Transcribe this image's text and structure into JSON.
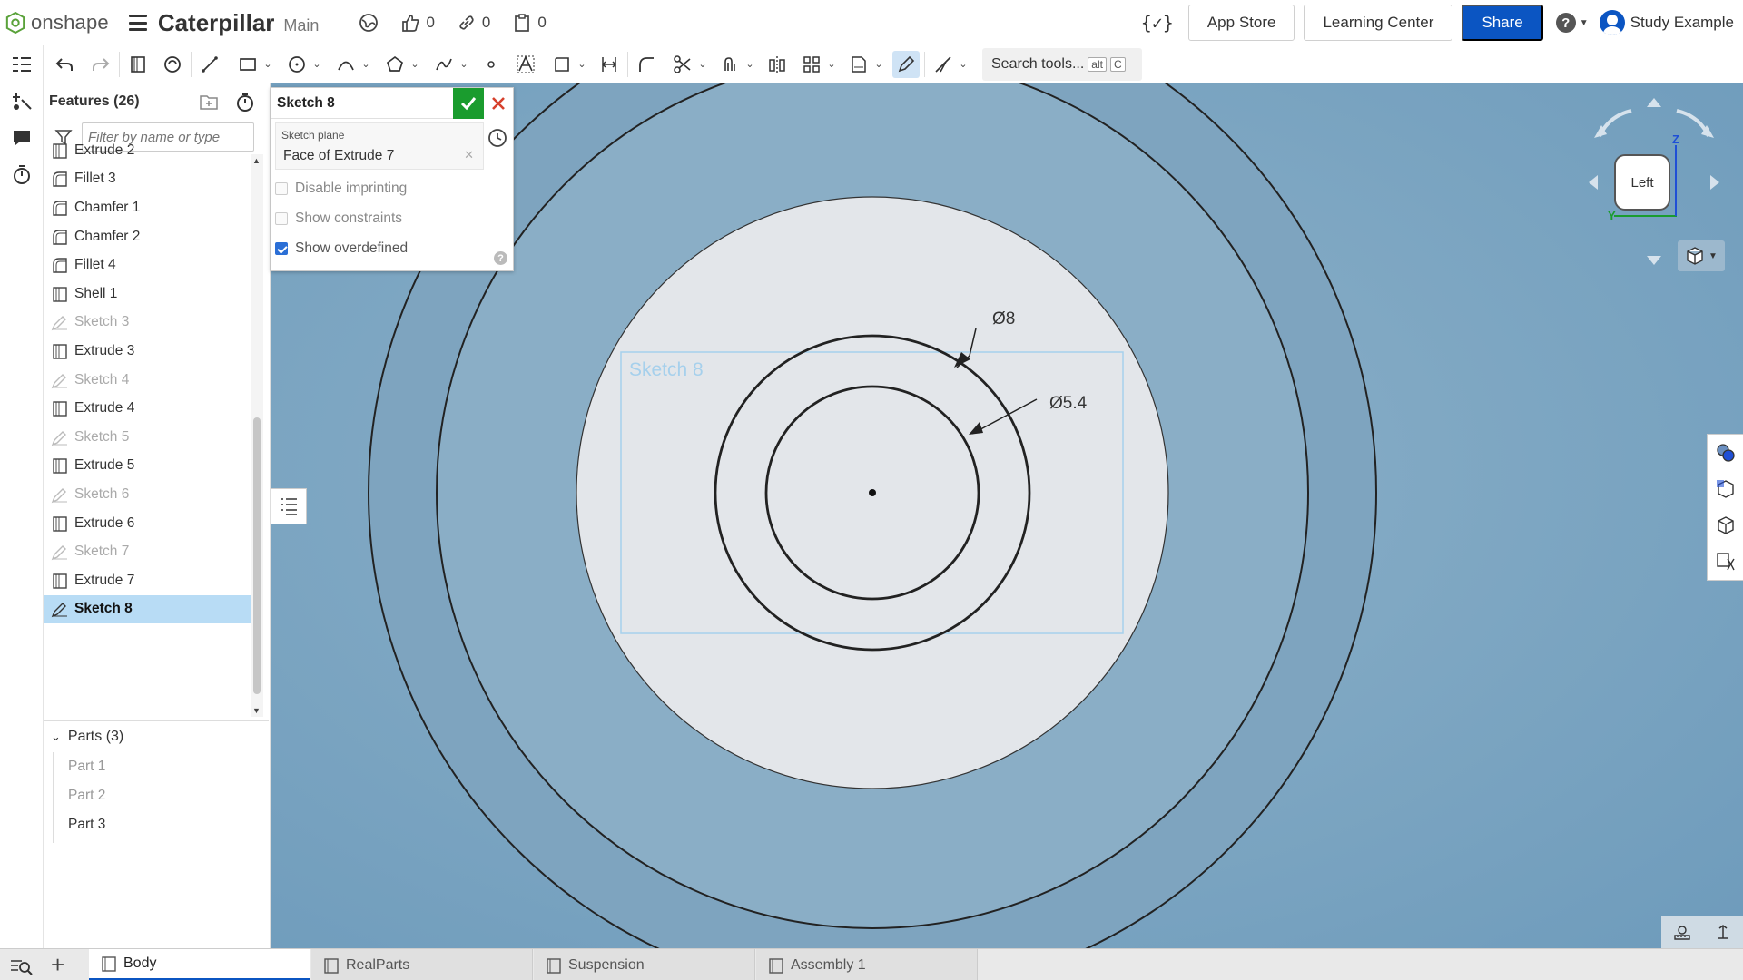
{
  "header": {
    "logo_text": "onshape",
    "doc_title": "Caterpillar",
    "branch": "Main",
    "likes": "0",
    "links": "0",
    "copies": "0",
    "app_store": "App Store",
    "learning_center": "Learning Center",
    "share": "Share",
    "user_name": "Study Example"
  },
  "toolbar": {
    "search_placeholder": "Search tools...",
    "search_key1": "alt",
    "search_key2": "C"
  },
  "features": {
    "title": "Features (26)",
    "filter_placeholder": "Filter by name or type",
    "items": [
      {
        "label": "Extrude 2",
        "type": "extrude"
      },
      {
        "label": "Fillet 3",
        "type": "fillet"
      },
      {
        "label": "Chamfer 1",
        "type": "chamfer"
      },
      {
        "label": "Chamfer 2",
        "type": "chamfer"
      },
      {
        "label": "Fillet 4",
        "type": "fillet"
      },
      {
        "label": "Shell 1",
        "type": "shell"
      },
      {
        "label": "Sketch 3",
        "type": "sketch"
      },
      {
        "label": "Extrude 3",
        "type": "extrude"
      },
      {
        "label": "Sketch 4",
        "type": "sketch"
      },
      {
        "label": "Extrude 4",
        "type": "extrude"
      },
      {
        "label": "Sketch 5",
        "type": "sketch"
      },
      {
        "label": "Extrude 5",
        "type": "extrude"
      },
      {
        "label": "Sketch 6",
        "type": "sketch"
      },
      {
        "label": "Extrude 6",
        "type": "extrude"
      },
      {
        "label": "Sketch 7",
        "type": "sketch"
      },
      {
        "label": "Extrude 7",
        "type": "extrude"
      },
      {
        "label": "Sketch 8",
        "type": "sketch-selected"
      }
    ],
    "parts_title": "Parts (3)",
    "parts": [
      {
        "label": "Part 1",
        "visible": false
      },
      {
        "label": "Part 2",
        "visible": false
      },
      {
        "label": "Part 3",
        "visible": true
      }
    ]
  },
  "sketch_dialog": {
    "title": "Sketch 8",
    "plane_label": "Sketch plane",
    "plane_value": "Face of Extrude 7",
    "opt_disable_imprinting": "Disable imprinting",
    "opt_show_constraints": "Show constraints",
    "opt_show_overdefined": "Show overdefined",
    "show_overdefined_checked": true
  },
  "viewport": {
    "sketch_label": "Sketch 8",
    "dim_outer": "Ø8",
    "dim_inner": "Ø5.4",
    "view_cube_face": "Left",
    "axis_z": "Z",
    "axis_y": "Y",
    "colors": {
      "background": "#7fa8c4",
      "face": "#e3e6ea",
      "sketch_box": "#a6d0ec"
    }
  },
  "tabs": [
    {
      "label": "Body",
      "active": true
    },
    {
      "label": "RealParts",
      "active": false
    },
    {
      "label": "Suspension",
      "active": false
    },
    {
      "label": "Assembly 1",
      "active": false
    }
  ]
}
